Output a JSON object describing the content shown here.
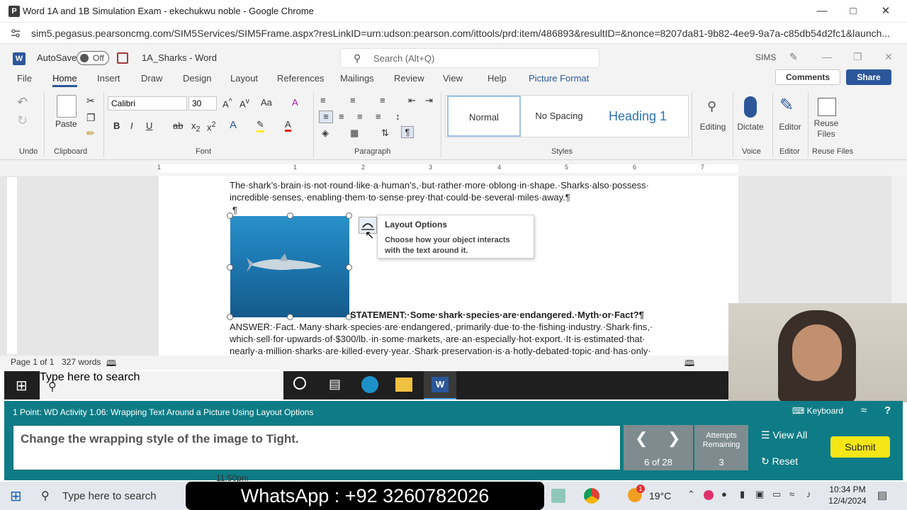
{
  "chrome": {
    "favicon": "P",
    "title": "Word 1A and 1B Simulation Exam - ekechukwu noble - Google Chrome",
    "url": "sim5.pegasus.pearsoncmg.com/SIM5Services/SIM5Frame.aspx?resLinkID=urn:udson:pearson.com/ittools/prd:item/486893&resultID=&nonce=8207da81-9b82-4ee9-9a7a-c85db54d2fc1&launch..."
  },
  "word": {
    "autosave_label": "AutoSave",
    "autosave_state": "Off",
    "doc_title": "1A_Sharks - Word",
    "search_placeholder": "Search (Alt+Q)",
    "user": "SIMS",
    "tabs": [
      "File",
      "Home",
      "Insert",
      "Draw",
      "Design",
      "Layout",
      "References",
      "Mailings",
      "Review",
      "View",
      "Help",
      "Picture Format"
    ],
    "comments_label": "Comments",
    "share_label": "Share",
    "ribbon": {
      "undo_label": "Undo",
      "clipboard_label": "Clipboard",
      "paste_label": "Paste",
      "font_label": "Font",
      "font_name": "Calibri",
      "font_size": "30",
      "paragraph_label": "Paragraph",
      "styles_label": "Styles",
      "style_normal": "Normal",
      "style_nospacing": "No Spacing",
      "style_heading1": "Heading 1",
      "editing_label": "Editing",
      "dictate_label": "Dictate",
      "voice_label": "Voice",
      "editor_label": "Editor",
      "editor_group_label": "Editor",
      "reuse_label": "Reuse Files",
      "reuse_group_label": "Reuse Files"
    },
    "ruler_numbers": [
      "1",
      "1",
      "2",
      "3",
      "4",
      "5",
      "6",
      "7"
    ],
    "document": {
      "line1": "The·shark’s·brain·is·not·round·like·a·human’s,·but·rather·more·oblong·in·shape.·Sharks·also·possess·",
      "line2": "incredible·senses,·enabling·them·to·sense·prey·that·could·be·several·miles·away.¶",
      "pilcrow": "¶",
      "statement": "STATEMENT:·Some·shark·species·are·endangered.·Myth·or·Fact?¶",
      "answer1": "ANSWER:·Fact.·Many·shark·species·are·endangered,·primarily·due·to·the·fishing·industry.·Shark·fins,·",
      "answer2": "which·sell·for·upwards·of·$300/lb.·in·some·markets,·are·an·especially·hot·export.·It·is·estimated·that·",
      "answer3": "nearly·a·million·sharks·are·killed·every·year.·Shark·preservation·is·a·hotly-debated·topic·and·has·only·"
    },
    "tooltip": {
      "title": "Layout Options",
      "body": "Choose how your object interacts with the text around it."
    },
    "status": {
      "page": "Page 1 of 1",
      "words": "327 words"
    }
  },
  "inner_taskbar": {
    "search_placeholder": "Type here to search"
  },
  "sim": {
    "header": "1 Point: WD Activity 1.06: Wrapping Text Around a Picture Using Layout Options",
    "keyboard_label": "Keyboard",
    "task": "Change the wrapping style of the image to Tight.",
    "position": "6 of 28",
    "attempts_label": "Attempts Remaining",
    "attempts_value": "3",
    "view_all_label": "View All",
    "reset_label": "Reset",
    "submit_label": "Submit",
    "partial_time": "11:50pm"
  },
  "os_taskbar": {
    "search_placeholder": "Type here to search",
    "banner": "WhatsApp : +92 3260782026",
    "temperature": "19°C",
    "time": "10:34 PM",
    "date": "12/4/2024",
    "weather_badge": "1"
  },
  "colors": {
    "word_blue": "#2b579a",
    "sim_teal": "#0e7c86",
    "submit_yellow": "#f5e617"
  }
}
